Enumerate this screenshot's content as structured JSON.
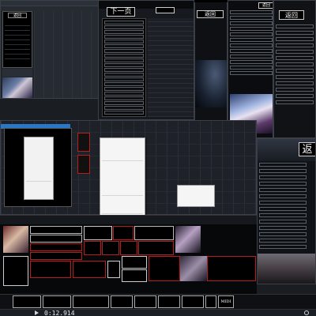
{
  "topleft": {
    "title_banner": "返回",
    "menu_rows": [
      "",
      "",
      "",
      "",
      "",
      "",
      "",
      ""
    ],
    "track_label": "",
    "track_label2": "",
    "tabs": [
      "",
      "",
      "",
      "",
      ""
    ]
  },
  "tall_panel": {
    "header_buttons": [
      "下一页",
      ""
    ],
    "rows": [
      "",
      "",
      "",
      "",
      "",
      "",
      "",
      "",
      "",
      "",
      "",
      "",
      "",
      "",
      "",
      "",
      "",
      "",
      "",
      "",
      "",
      "",
      "",
      "",
      "",
      ""
    ],
    "title": "返回"
  },
  "dark_preview": {
    "top_label": "返回",
    "small_list": [
      "",
      "",
      "",
      "",
      "",
      "",
      "",
      ""
    ],
    "side_rows": [
      "",
      "",
      "",
      "",
      "",
      "",
      "",
      "",
      "",
      "",
      "",
      "",
      ""
    ]
  },
  "right_list": {
    "header": "返回",
    "rows": [
      "",
      "",
      "",
      "",
      "",
      "",
      "",
      "",
      "",
      "",
      "",
      ""
    ]
  },
  "mid_left": {
    "banner_chars": [
      "",
      ""
    ],
    "menu_items": [
      "",
      "",
      "",
      "",
      "",
      "",
      "",
      "",
      "",
      "",
      ""
    ]
  },
  "context_menu": {
    "items": [
      "",
      "",
      "",
      "",
      "",
      "",
      "",
      "",
      "",
      "",
      "",
      "",
      "",
      "",
      "",
      "",
      "",
      "",
      "",
      ""
    ]
  },
  "submenu": {
    "items": [
      "",
      "",
      "",
      ""
    ]
  },
  "right_panel": {
    "header": "返",
    "rows": [
      "",
      "",
      "",
      "",
      "",
      "",
      "",
      "",
      "",
      "",
      "",
      "",
      "",
      ""
    ]
  },
  "colored_grid": {
    "red_buttons": [
      "",
      "",
      "",
      "",
      "",
      "",
      "",
      "",
      "",
      "",
      "",
      "",
      "",
      "",
      ""
    ],
    "pink_buttons": [
      "",
      "",
      ""
    ],
    "white_buttons": [
      "",
      "",
      "",
      "",
      ""
    ],
    "bottom_left_title": "",
    "bottom_center": [
      "",
      ""
    ],
    "bottom_right": [
      "",
      ""
    ]
  },
  "mid_strip": {
    "labels": [
      "",
      "",
      "",
      "",
      "",
      "",
      "",
      "",
      "",
      ""
    ]
  },
  "bottom_toolbar": {
    "buttons": [
      "",
      "",
      "",
      "",
      "",
      "",
      "",
      "",
      "MIDI设置"
    ],
    "time": "0:12.914",
    "right_values": [
      "",
      ""
    ]
  },
  "colors": {
    "accent_red": "#e01b24",
    "accent_pink": "#ff2a8a",
    "meter_green": "#35e15a",
    "background": "#1a1d22",
    "panel": "#20242b"
  }
}
